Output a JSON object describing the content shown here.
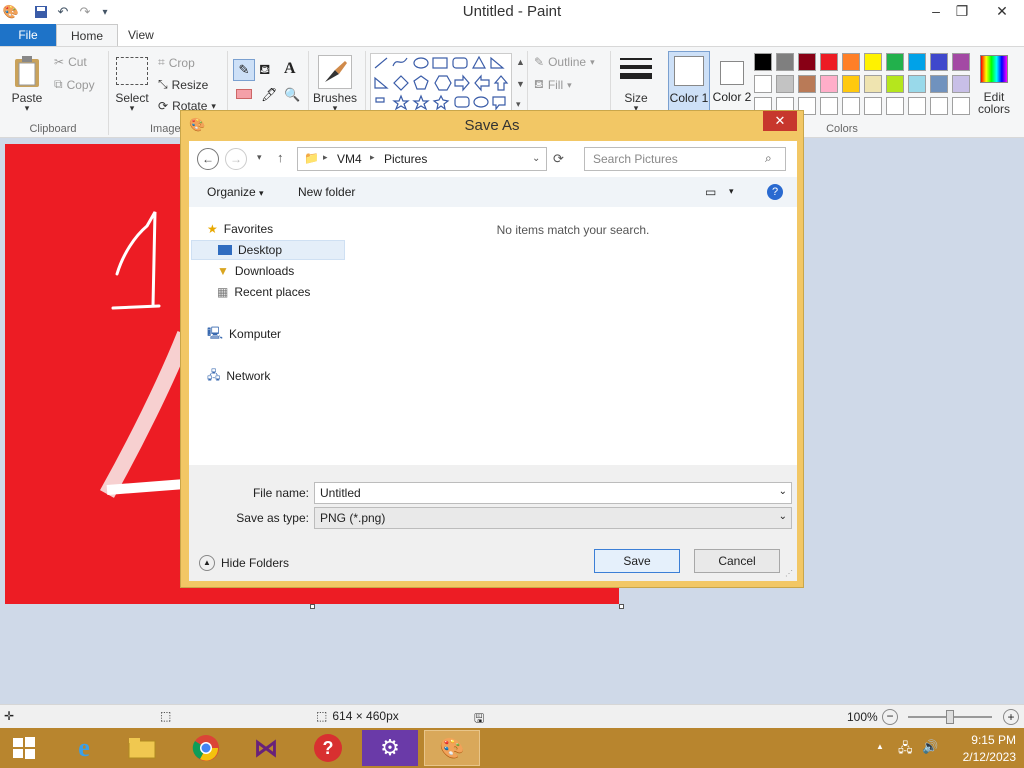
{
  "window": {
    "title": "Untitled - Paint"
  },
  "tabs": {
    "file": "File",
    "home": "Home",
    "view": "View"
  },
  "ribbon": {
    "clipboard": {
      "paste": "Paste",
      "cut": "Cut",
      "copy": "Copy",
      "group": "Clipboard"
    },
    "image": {
      "select": "Select",
      "crop": "Crop",
      "resize": "Resize",
      "rotate": "Rotate",
      "group": "Image"
    },
    "brushes": "Brushes",
    "shapes": {
      "outline": "Outline",
      "fill": "Fill"
    },
    "size": "Size",
    "color1": "Color 1",
    "color2": "Color 2",
    "edit_colors": "Edit colors",
    "colors_group": "Colors",
    "palette_row1": [
      "#000000",
      "#7f7f7f",
      "#880015",
      "#ed1c24",
      "#ff7f27",
      "#fff200",
      "#22b14c",
      "#00a2e8",
      "#3f48cc",
      "#a349a4"
    ],
    "palette_row2": [
      "#ffffff",
      "#c3c3c3",
      "#b97a57",
      "#ffaec9",
      "#ffc90e",
      "#efe4b0",
      "#b5e61d",
      "#99d9ea",
      "#7092be",
      "#c8bfe7"
    ]
  },
  "dialog": {
    "title": "Save As",
    "address": {
      "root": "VM4",
      "folder": "Pictures"
    },
    "search_placeholder": "Search Pictures",
    "organize": "Organize",
    "new_folder": "New folder",
    "empty_message": "No items match your search.",
    "nav": {
      "favorites": "Favorites",
      "desktop": "Desktop",
      "downloads": "Downloads",
      "recent": "Recent places",
      "computer": "Komputer",
      "network": "Network"
    },
    "file_name_label": "File name:",
    "file_name_value": "Untitled",
    "save_type_label": "Save as type:",
    "save_type_value": "PNG (*.png)",
    "hide_folders": "Hide Folders",
    "save": "Save",
    "cancel": "Cancel"
  },
  "statusbar": {
    "dimensions": "614 × 460px",
    "zoom": "100%"
  },
  "taskbar": {
    "time": "9:15 PM",
    "date": "2/12/2023"
  }
}
